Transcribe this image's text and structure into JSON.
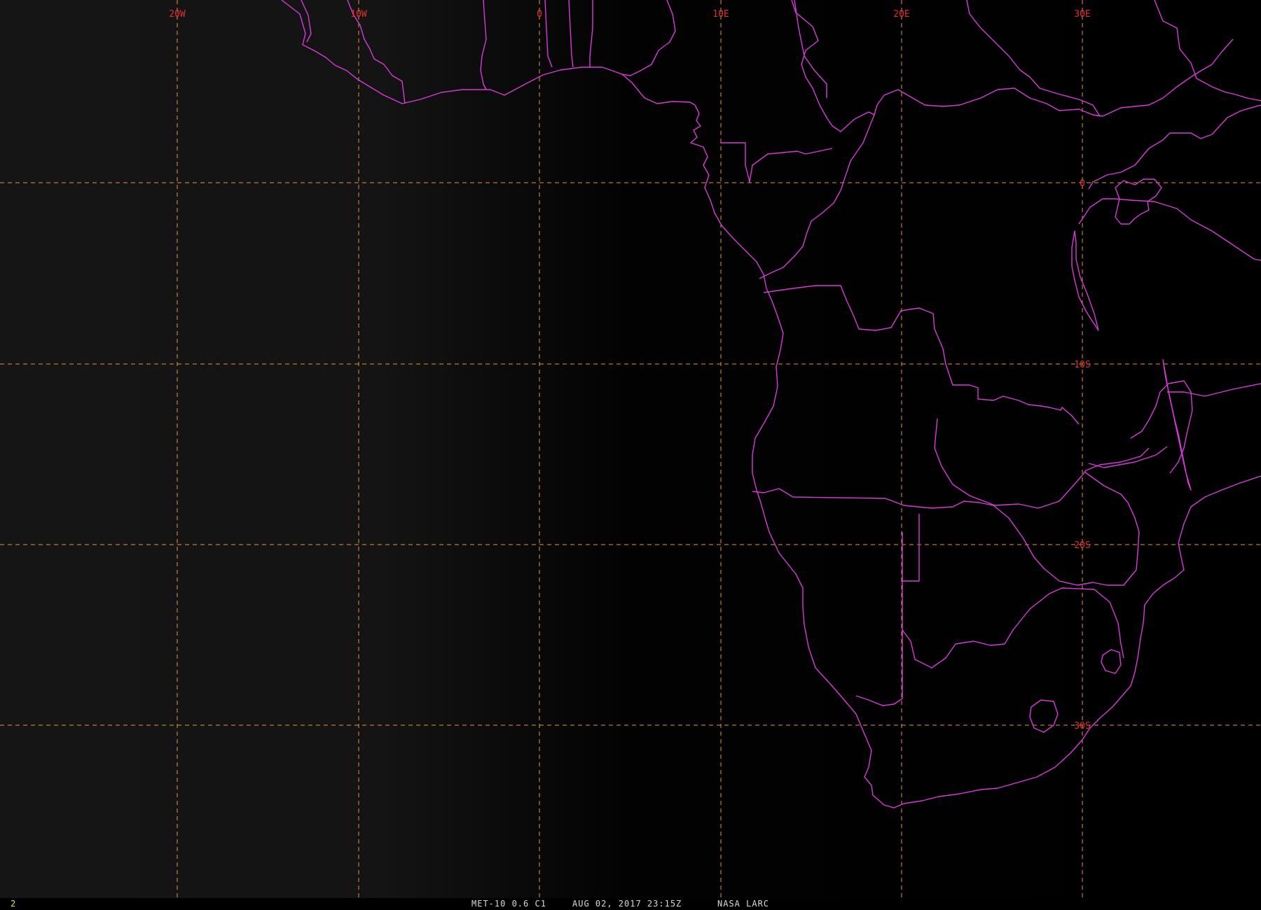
{
  "map": {
    "background_color": "#000000",
    "graticule_color": "#e8953a",
    "label_color": "#e03030",
    "border_color": "#d83ad8",
    "longitude_labels": [
      "20W",
      "10W",
      "0",
      "10E",
      "20E",
      "30E"
    ],
    "latitude_labels": [
      "0",
      "10S",
      "20S",
      "30S"
    ]
  },
  "status": {
    "frame": "2",
    "satellite": "MET-10 0.6 C1",
    "datetime": "AUG 02, 2017 23:15Z",
    "source": "NASA LARC"
  }
}
